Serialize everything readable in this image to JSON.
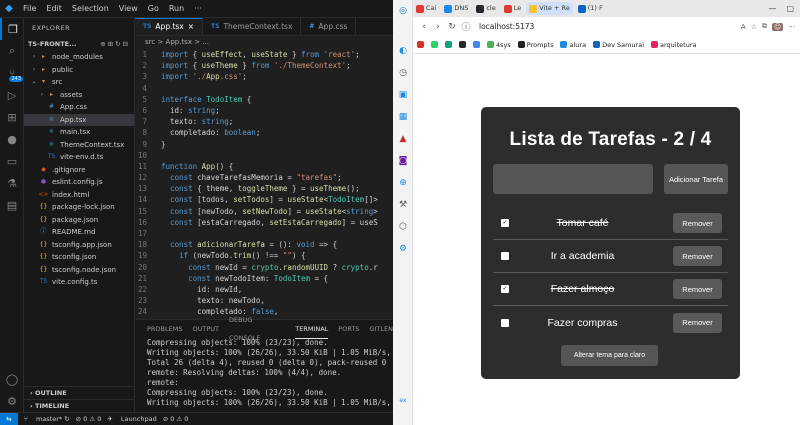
{
  "vscode": {
    "menu": [
      "File",
      "Edit",
      "Selection",
      "View",
      "Go",
      "Run",
      "···"
    ],
    "explorer_title": "EXPLORER",
    "project": "TS-FRONTE...",
    "tree": [
      {
        "label": "node_modules",
        "kind": "folder",
        "depth": 1
      },
      {
        "label": "public",
        "kind": "folder",
        "depth": 1
      },
      {
        "label": "src",
        "kind": "folder-open",
        "depth": 1
      },
      {
        "label": "assets",
        "kind": "folder",
        "depth": 2
      },
      {
        "label": "App.css",
        "kind": "css",
        "depth": 2
      },
      {
        "label": "App.tsx",
        "kind": "tsx",
        "depth": 2,
        "selected": true
      },
      {
        "label": "main.tsx",
        "kind": "tsx",
        "depth": 2
      },
      {
        "label": "ThemeContext.tsx",
        "kind": "tsx",
        "depth": 2
      },
      {
        "label": "vite-env.d.ts",
        "kind": "ts",
        "depth": 2
      },
      {
        "label": ".gitignore",
        "kind": "git",
        "depth": 1
      },
      {
        "label": "eslint.config.js",
        "kind": "js",
        "depth": 1
      },
      {
        "label": "index.html",
        "kind": "html",
        "depth": 1
      },
      {
        "label": "package-lock.json",
        "kind": "json",
        "depth": 1
      },
      {
        "label": "package.json",
        "kind": "json",
        "depth": 1
      },
      {
        "label": "README.md",
        "kind": "md",
        "depth": 1
      },
      {
        "label": "tsconfig.app.json",
        "kind": "json",
        "depth": 1
      },
      {
        "label": "tsconfig.json",
        "kind": "json",
        "depth": 1
      },
      {
        "label": "tsconfig.node.json",
        "kind": "json",
        "depth": 1
      },
      {
        "label": "vite.config.ts",
        "kind": "ts",
        "depth": 1
      }
    ],
    "outline": "OUTLINE",
    "timeline": "TIMELINE",
    "tabs": [
      "App.tsx",
      "ThemeContext.tsx",
      "App.css"
    ],
    "breadcrumb": "src > App.tsx > ...",
    "code": [
      "import { useEffect, useState } from 'react';",
      "import { useTheme } from './ThemeContext';",
      "import './App.css';",
      "",
      "interface TodoItem {",
      "  id: string;",
      "  texto: string;",
      "  completado: boolean;",
      "}",
      "",
      "function App() {",
      "  const chaveTarefasMemoria = \"tarefas\";",
      "  const { theme, toggleTheme } = useTheme();",
      "  const [todos, setTodos] = useState<TodoItem[]>",
      "  const [newTodo, setNewTodo] = useState<string>",
      "  const [estaCarregado, setEstaCarregado] = useS",
      "",
      "  const adicionarTarefa = (): void => {",
      "    if (newTodo.trim() !== \"\") {",
      "      const newId = crypto.randomUUID ? crypto.r",
      "      const newTodoItem: TodoItem = {",
      "        id: newId,",
      "        texto: newTodo,",
      "        completado: false,"
    ],
    "panel_tabs": [
      "PROBLEMS",
      "OUTPUT",
      "DEBUG CONSOLE",
      "TERMINAL",
      "PORTS",
      "GITLEN"
    ],
    "terminal": [
      "Compressing objects: 100% (23/23), done.",
      "Writing objects: 100% (26/26), 33.50 KiB | 1.05 MiB/s,",
      "Total 26 (delta 4), reused 0 (delta 0), pack-reused 0",
      "remote: Resolving deltas: 100% (4/4), done.",
      "remote:",
      "Compressing objects: 100% (23/23), done.",
      "Writing objects: 100% (26/26), 33.50 KiB | 1.05 MiB/s,"
    ],
    "status": {
      "branch": "master*",
      "sync": "⊘ 0 ⚠ 0",
      "launch": "Launchpad",
      "ports": "⊘ 0 ⚠ 0"
    },
    "activity_badge": "243"
  },
  "browser": {
    "tabs": [
      {
        "label": "Cai",
        "color": "#e53935"
      },
      {
        "label": "DNS",
        "color": "#1e88e5"
      },
      {
        "label": "cle",
        "color": "#24292f"
      },
      {
        "label": "Le",
        "color": "#e53935"
      },
      {
        "label": "Vite + Re",
        "color": "#fbc02d",
        "active": true
      },
      {
        "label": "(1) F",
        "color": "#0a66c2"
      }
    ],
    "url": "localhost:5173",
    "bookmarks": [
      "4sys",
      "Prompts",
      "alura",
      "Dev Samurai",
      "arquitetura"
    ]
  },
  "app": {
    "title": "Lista de Tarefas - 2 / 4",
    "input_value": "",
    "add_button": "Adicionar Tarefa",
    "remove_label": "Remover",
    "tasks": [
      {
        "text": "Tomar café",
        "done": true
      },
      {
        "text": "Ir a academia",
        "done": false
      },
      {
        "text": "Fazer almoço",
        "done": true
      },
      {
        "text": "Fazer compras",
        "done": false
      }
    ],
    "theme_button": "Alterar tema para claro"
  }
}
